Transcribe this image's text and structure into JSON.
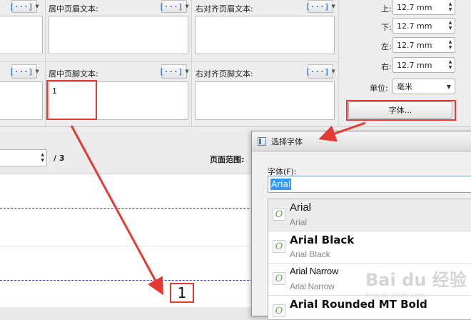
{
  "header_footer": {
    "left_header_textbox": "",
    "center_header_label": "居中页眉文本:",
    "right_header_label": "右对齐页眉文本:",
    "center_footer_label": "居中页脚文本:",
    "center_footer_value": "1",
    "right_footer_label": "右对齐页脚文本:",
    "field_button_glyph": "[···]"
  },
  "margins": {
    "top_label": "上:",
    "top_value": "12.7 mm",
    "bottom_label": "下:",
    "bottom_value": "12.7 mm",
    "left_label": "左:",
    "left_value": "12.7 mm",
    "right_label": "右:",
    "right_value": "12.7 mm",
    "unit_label": "单位:",
    "unit_value": "毫米",
    "font_button": "字体..."
  },
  "nav": {
    "page_total": "/ 3",
    "page_range_label": "页面范围:"
  },
  "preview": {
    "footer_number": "1"
  },
  "font_dialog": {
    "title": "选择字体",
    "font_label": "字体(F):",
    "font_input_value": "Arial",
    "fonts": [
      {
        "name": "Arial",
        "sample": "Arial"
      },
      {
        "name": "Arial Black",
        "sample": "Arial Black"
      },
      {
        "name": "Arial Narrow",
        "sample": "Arial Narrow"
      },
      {
        "name": "Arial Rounded MT Bold",
        "sample": ""
      }
    ],
    "type_icon_glyph": "O"
  },
  "watermark": {
    "text": "Bai du 经验",
    "url": "jingyan.baidu.com"
  },
  "colors": {
    "accent_red": "#e53935",
    "field_blue": "#3a7bd5",
    "dash_line": "#3a46c7"
  }
}
